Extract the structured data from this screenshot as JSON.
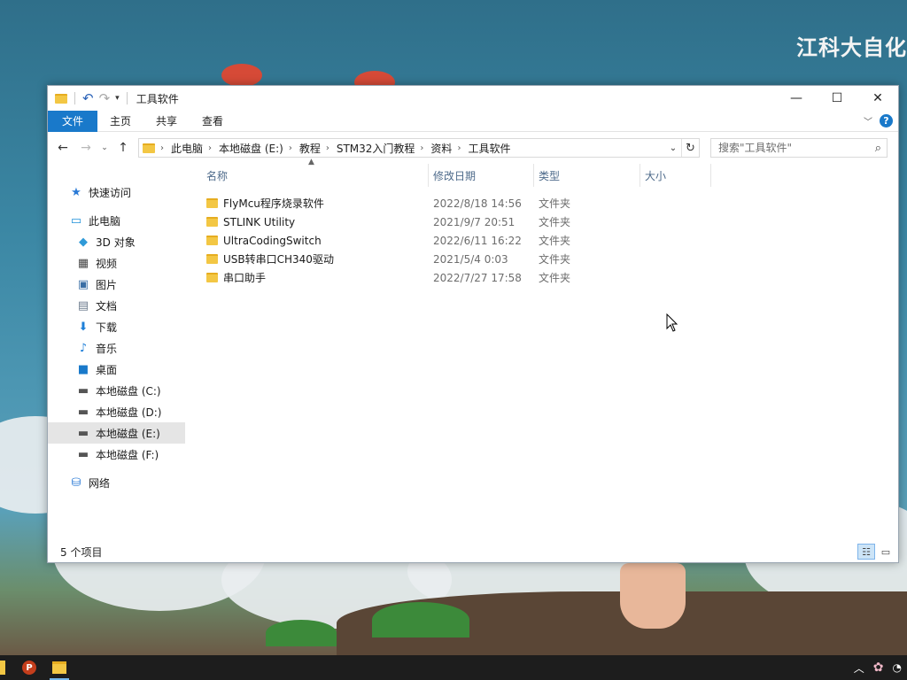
{
  "wallpaper": {
    "overlay_text": "江科大自化"
  },
  "window": {
    "title": "工具软件",
    "controls": {
      "minimize": "—",
      "maximize": "☐",
      "close": "✕"
    }
  },
  "ribbon": {
    "tabs": [
      {
        "label": "文件",
        "active": true
      },
      {
        "label": "主页"
      },
      {
        "label": "共享"
      },
      {
        "label": "查看"
      }
    ],
    "help": "?"
  },
  "address": {
    "crumbs": [
      "此电脑",
      "本地磁盘 (E:)",
      "教程",
      "STM32入门教程",
      "资料",
      "工具软件"
    ]
  },
  "search": {
    "placeholder": "搜索\"工具软件\""
  },
  "sidebar": {
    "quick_access": "快速访问",
    "this_pc": "此电脑",
    "items": [
      {
        "label": "3D 对象",
        "icon": "3d-objects-icon"
      },
      {
        "label": "视频",
        "icon": "video-icon"
      },
      {
        "label": "图片",
        "icon": "pictures-icon"
      },
      {
        "label": "文档",
        "icon": "documents-icon"
      },
      {
        "label": "下载",
        "icon": "download-icon"
      },
      {
        "label": "音乐",
        "icon": "music-icon"
      },
      {
        "label": "桌面",
        "icon": "desktop-icon"
      },
      {
        "label": "本地磁盘 (C:)",
        "icon": "drive-icon"
      },
      {
        "label": "本地磁盘 (D:)",
        "icon": "drive-icon"
      },
      {
        "label": "本地磁盘 (E:)",
        "icon": "drive-icon",
        "selected": true
      },
      {
        "label": "本地磁盘 (F:)",
        "icon": "drive-icon"
      }
    ],
    "network": "网络"
  },
  "columns": {
    "name": "名称",
    "date": "修改日期",
    "type": "类型",
    "size": "大小"
  },
  "files": [
    {
      "name": "FlyMcu程序烧录软件",
      "date": "2022/8/18 14:56",
      "type": "文件夹"
    },
    {
      "name": "STLINK Utility",
      "date": "2021/9/7 20:51",
      "type": "文件夹"
    },
    {
      "name": "UltraCodingSwitch",
      "date": "2022/6/11 16:22",
      "type": "文件夹"
    },
    {
      "name": "USB转串口CH340驱动",
      "date": "2021/5/4 0:03",
      "type": "文件夹"
    },
    {
      "name": "串口助手",
      "date": "2022/7/27 17:58",
      "type": "文件夹"
    }
  ],
  "status": {
    "count_text": "5 个项目"
  },
  "taskbar": {
    "apps": [
      {
        "name": "powerpoint",
        "glyph": "P"
      },
      {
        "name": "file-explorer",
        "active": true
      }
    ]
  },
  "colors": {
    "accent": "#1979ca",
    "selected_bg": "#e5e5e5",
    "header_text": "#4d6a8a"
  }
}
